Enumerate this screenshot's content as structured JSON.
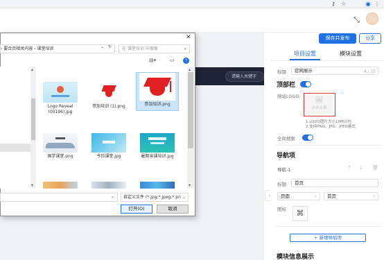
{
  "browser": {
    "key_icon": "key-icon",
    "star_icon": "star-icon",
    "menu_icon": "more-vert-icon"
  },
  "header": {
    "expand_icon": "fullscreen-icon",
    "save_publish": "保存并发布",
    "share": "分享"
  },
  "canvas": {
    "search_placeholder": "请输入关键字"
  },
  "panel": {
    "tabs": [
      {
        "label": "项目设置",
        "active": true
      },
      {
        "label": "模块设置",
        "active": false
      }
    ],
    "title_label": "标题",
    "title_value": "官网展示",
    "title_counter": "4 / 15",
    "topbar_title": "顶部栏",
    "topbar_enabled": true,
    "logo_label": "网站LOGO:",
    "upload_text": "点击上传",
    "hint_1": "1.LOGO图片大小10M以内",
    "hint_2": "2.支持PNG、JPG、JPEG格式",
    "global_search_label": "全局搜索",
    "global_search_enabled": true,
    "nav_section_title": "导航项",
    "nav_item_title": "导航-1",
    "nav_title_label": "标题",
    "nav_title_value": "首页",
    "nav_type_value": "页面",
    "nav_page_value": "首页",
    "icon_label": "图标",
    "add_nav_button": "+ 新增导航项",
    "module_info_title": "模块信息展示"
  },
  "dialog": {
    "breadcrumb": "› 要合页相关内容 › 课堂培训",
    "search_placeholder": "在 课堂培训 中搜索",
    "files": [
      {
        "name": "Logo Reveal (00196).jpg",
        "kind": "logo-reveal"
      },
      {
        "name": "参加培训 (1).png",
        "kind": "grad-cap-small"
      },
      {
        "name": "参加培训.png",
        "kind": "grad-cap-large",
        "selected": true
      },
      {
        "name": "国学课堂.png",
        "kind": "ink-landscape"
      },
      {
        "name": "今日课堂.jpg",
        "kind": "blue-gradient"
      },
      {
        "name": "暑期亲课培训.jpg",
        "kind": "teal-banner"
      },
      {
        "name": "",
        "kind": "partial-1"
      },
      {
        "name": "",
        "kind": "partial-2"
      },
      {
        "name": "",
        "kind": "partial-3"
      }
    ],
    "filetype_value": "自定义文件 (*.jpg;*.jpeg;*.pn",
    "open_button": "打开(O)",
    "cancel_button": "取消"
  }
}
